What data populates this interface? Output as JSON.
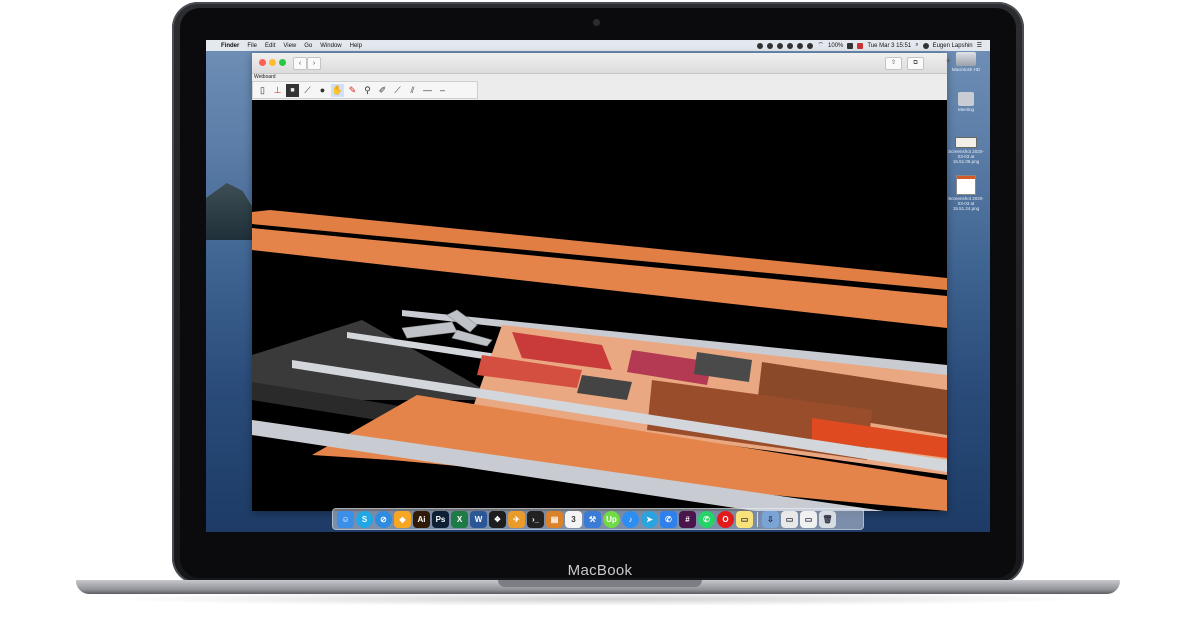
{
  "device": {
    "brand": "MacBook"
  },
  "menubar": {
    "app": "Finder",
    "items": [
      "File",
      "Edit",
      "View",
      "Go",
      "Window",
      "Help"
    ],
    "battery": "100%",
    "datetime": "Tue Mar 3  15:51",
    "user": "Eugen Lapshin"
  },
  "window": {
    "app_title": "Wetboard",
    "nav_back": "‹",
    "nav_forward": "›"
  },
  "toolbar": {
    "tools": [
      {
        "name": "page-tool-icon",
        "glyph": "▯"
      },
      {
        "name": "marker-tool-icon",
        "glyph": "⊥"
      },
      {
        "name": "layer-tool-icon",
        "glyph": "■"
      },
      {
        "name": "knife-tool-icon",
        "glyph": "⟋"
      },
      {
        "name": "sphere-tool-icon",
        "glyph": "●"
      },
      {
        "name": "grab-tool-icon",
        "glyph": "✋"
      },
      {
        "name": "pin-tool-icon",
        "glyph": "✎"
      },
      {
        "name": "probe-tool-icon",
        "glyph": "⚲"
      },
      {
        "name": "brush-tool-icon",
        "glyph": "✐"
      },
      {
        "name": "line-tool-icon",
        "glyph": "⟋"
      },
      {
        "name": "multi-line-tool-icon",
        "glyph": "⫽"
      },
      {
        "name": "flat-line-tool-icon",
        "glyph": "—"
      },
      {
        "name": "dash-tool-icon",
        "glyph": "–"
      }
    ]
  },
  "desktop": {
    "icons": [
      {
        "label": "Macintosh HD"
      },
      {
        "label": "Meeting"
      },
      {
        "label": "Screenshot 2020-03-03 at 15.51.06.png"
      },
      {
        "label": "Screenshot 2020-03-03 at 15.51.24.png"
      }
    ]
  },
  "dock": {
    "apps": [
      {
        "name": "finder-icon",
        "glyph": "☺",
        "color": "#3b8fe8"
      },
      {
        "name": "skype-icon",
        "glyph": "S",
        "color": "#1fa7e6",
        "round": true
      },
      {
        "name": "safari-icon",
        "glyph": "⊘",
        "color": "#2f8be0",
        "round": true
      },
      {
        "name": "sketch-icon",
        "glyph": "◆",
        "color": "#f5a623"
      },
      {
        "name": "illustrator-icon",
        "glyph": "Ai",
        "color": "#2e1a06"
      },
      {
        "name": "photoshop-icon",
        "glyph": "Ps",
        "color": "#0d1f33"
      },
      {
        "name": "excel-icon",
        "glyph": "X",
        "color": "#1e7b45"
      },
      {
        "name": "word-icon",
        "glyph": "W",
        "color": "#2b5797"
      },
      {
        "name": "figma-icon",
        "glyph": "❖",
        "color": "#1e1e1e"
      },
      {
        "name": "transmit-icon",
        "glyph": "✈",
        "color": "#e89a2a"
      },
      {
        "name": "terminal-icon",
        "glyph": "›_",
        "color": "#222"
      },
      {
        "name": "books-icon",
        "glyph": "▤",
        "color": "#d9822b"
      },
      {
        "name": "calendar-icon",
        "glyph": "3",
        "color": "#f4f4f4"
      },
      {
        "name": "xcode-icon",
        "glyph": "⚒",
        "color": "#3a7bd5"
      },
      {
        "name": "upwork-icon",
        "glyph": "Up",
        "color": "#6fda44",
        "round": true
      },
      {
        "name": "music-icon",
        "glyph": "♪",
        "color": "#2d8df0",
        "round": true
      },
      {
        "name": "telegram-icon",
        "glyph": "➤",
        "color": "#2aa3e0",
        "round": true
      },
      {
        "name": "messenger-icon",
        "glyph": "✆",
        "color": "#2f80ed"
      },
      {
        "name": "slack-icon",
        "glyph": "#",
        "color": "#4a154b"
      },
      {
        "name": "whatsapp-icon",
        "glyph": "✆",
        "color": "#25d366",
        "round": true
      },
      {
        "name": "opera-icon",
        "glyph": "O",
        "color": "#e21a1a",
        "round": true
      },
      {
        "name": "notes-icon",
        "glyph": "▭",
        "color": "#f7e27b"
      }
    ],
    "docs": [
      {
        "name": "downloads-stack-icon",
        "glyph": "⇩",
        "color": "#7aa3d6"
      },
      {
        "name": "screenshot-stack-icon",
        "glyph": "▭",
        "color": "#e8e8e8"
      },
      {
        "name": "document-stack-icon",
        "glyph": "▭",
        "color": "#f0f0f0"
      },
      {
        "name": "trash-icon",
        "glyph": "🗑",
        "color": "#d8dde3"
      }
    ]
  },
  "colors": {
    "board_orange": "#e5844a",
    "rail_silver": "#c8ccd2",
    "viewport_bg": "#000000"
  }
}
